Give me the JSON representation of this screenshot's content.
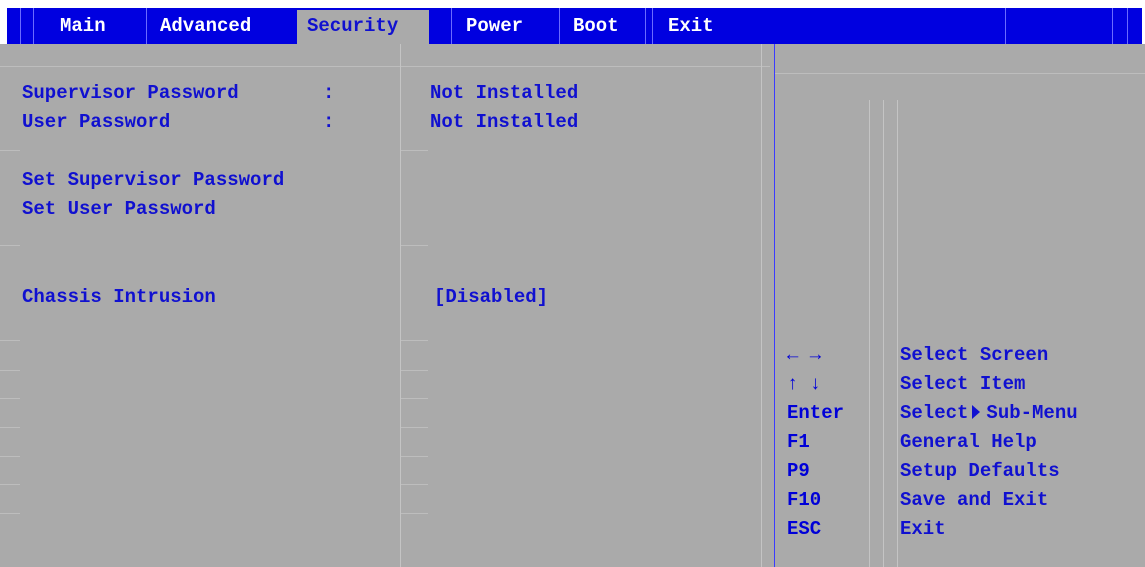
{
  "tabs": [
    "Main",
    "Advanced",
    "Security",
    "Power",
    "Boot",
    "Exit"
  ],
  "active_tab": "Security",
  "settings": {
    "supervisor_password": {
      "label": "Supervisor Password",
      "colon": ":",
      "value": "Not Installed"
    },
    "user_password": {
      "label": "User Password",
      "colon": ":",
      "value": "Not Installed"
    },
    "set_supervisor_password": {
      "label": "Set Supervisor Password"
    },
    "set_user_password": {
      "label": "Set User Password"
    },
    "chassis_intrusion": {
      "label": "Chassis Intrusion",
      "value": "[Disabled]"
    }
  },
  "help_keys": [
    {
      "key": "← →",
      "icon": "left-right-arrows-icon",
      "desc": "Select Screen"
    },
    {
      "key": "↑ ↓",
      "icon": "up-down-arrows-icon",
      "desc": "Select Item"
    },
    {
      "key": "Enter",
      "desc_pre": "Select",
      "desc_icon": "right-triangle-icon",
      "desc_post": "Sub-Menu"
    },
    {
      "key": "F1",
      "desc": "General Help"
    },
    {
      "key": "P9",
      "desc": "Setup Defaults"
    },
    {
      "key": "F10",
      "desc": "Save and Exit"
    },
    {
      "key": "ESC",
      "desc": "Exit"
    }
  ],
  "colors": {
    "menu_blue": "#0000e0",
    "panel_gray": "#aaaaaa",
    "text_blue": "#1010d0"
  }
}
